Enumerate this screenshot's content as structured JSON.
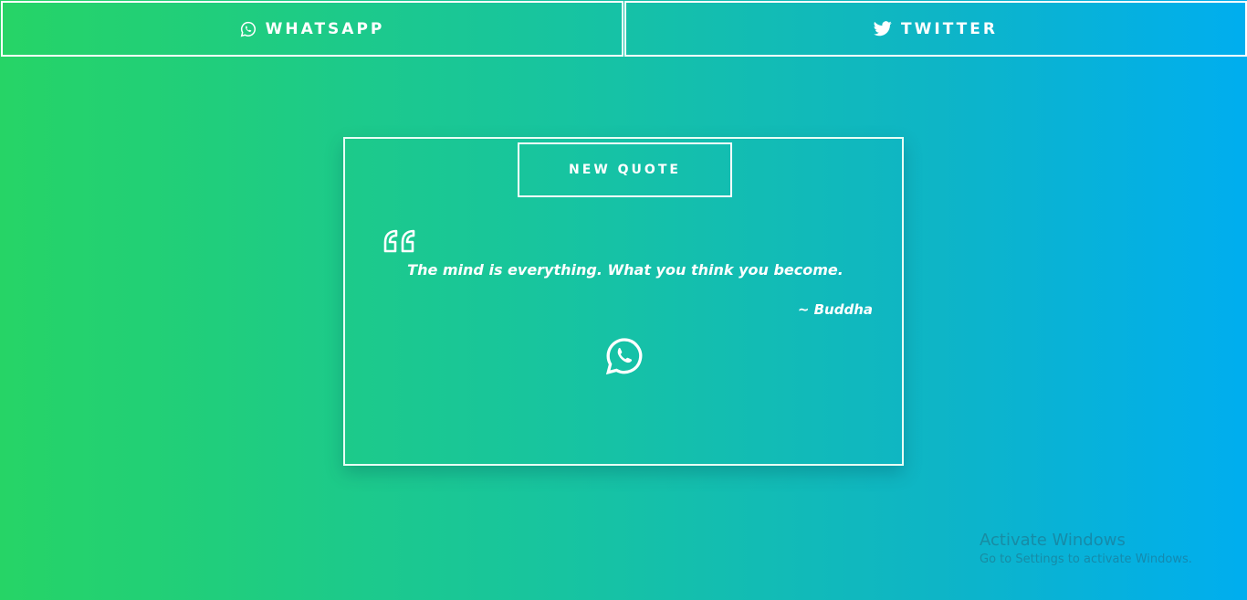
{
  "topbar": {
    "whatsapp_label": "WHATSAPP",
    "twitter_label": "TWITTER",
    "whatsapp_icon": "whatsapp-icon",
    "twitter_icon": "twitter-icon"
  },
  "card": {
    "new_quote_label": "NEW QUOTE",
    "quote_icon": "quote-left-icon",
    "quote_text": "The mind is everything. What you think you become.",
    "author": "~ Buddha",
    "share_icon": "whatsapp-icon"
  },
  "watermark": {
    "title": "Activate Windows",
    "subtitle": "Go to Settings to activate Windows."
  },
  "colors": {
    "gradient_start": "#26d466",
    "gradient_end": "#00aeef",
    "foreground": "#ffffff"
  }
}
